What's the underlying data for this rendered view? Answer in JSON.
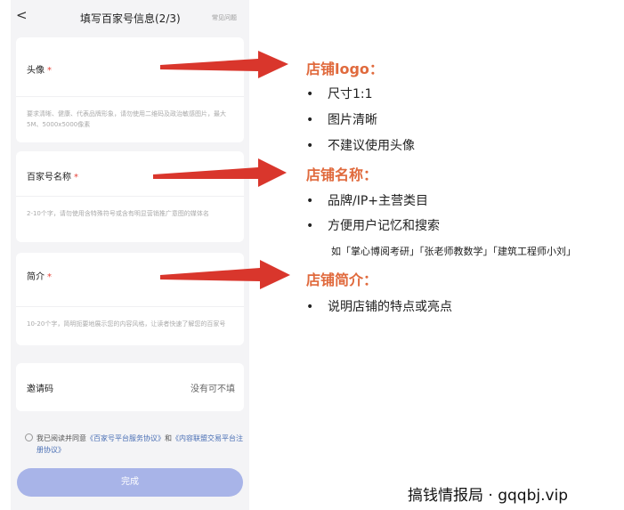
{
  "header": {
    "back": "<",
    "title": "填写百家号信息(2/3)",
    "faq": "常见问题"
  },
  "fields": {
    "avatar": {
      "label": "头像",
      "required": "*",
      "hint": "要求清晰、健康、代表品牌形象，请勿使用二维码及政治敏感图片，最大5M、5000x5000像素"
    },
    "name": {
      "label": "百家号名称",
      "required": "*",
      "hint": "2-10个字，请勿使用含特殊符号或含有明显营销推广意图的媒体名"
    },
    "intro": {
      "label": "简介",
      "required": "*",
      "hint": "10-20个字，简明扼要地展示您的内容风格，让读者快速了解您的百家号"
    },
    "invite": {
      "label": "邀请码",
      "value": "没有可不填"
    }
  },
  "agreement": {
    "prefix": "我已阅读并同意",
    "link1": "《百家号平台服务协议》",
    "mid": "和",
    "link2": "《内容联盟交易平台注册协议》"
  },
  "submit": "完成",
  "annotations": {
    "logo": {
      "title": "店铺logo：",
      "bullets": [
        "尺寸1:1",
        "图片清晰",
        "不建议使用头像"
      ]
    },
    "name": {
      "title": "店铺名称：",
      "bullets": [
        "品牌/IP+主营类目",
        "方便用户记忆和搜索"
      ],
      "example": "如「掌心博阅考研」「张老师教数学」「建筑工程师小刘」"
    },
    "intro": {
      "title": "店铺简介：",
      "bullets": [
        "说明店铺的特点或亮点"
      ]
    },
    "bullet_char": "•"
  },
  "footer": "搞钱情报局 · gqqbj.vip",
  "colors": {
    "accent": "#e06a3d",
    "arrow": "#d9362c",
    "button": "#a8b4e8",
    "link": "#4a6fb5"
  }
}
